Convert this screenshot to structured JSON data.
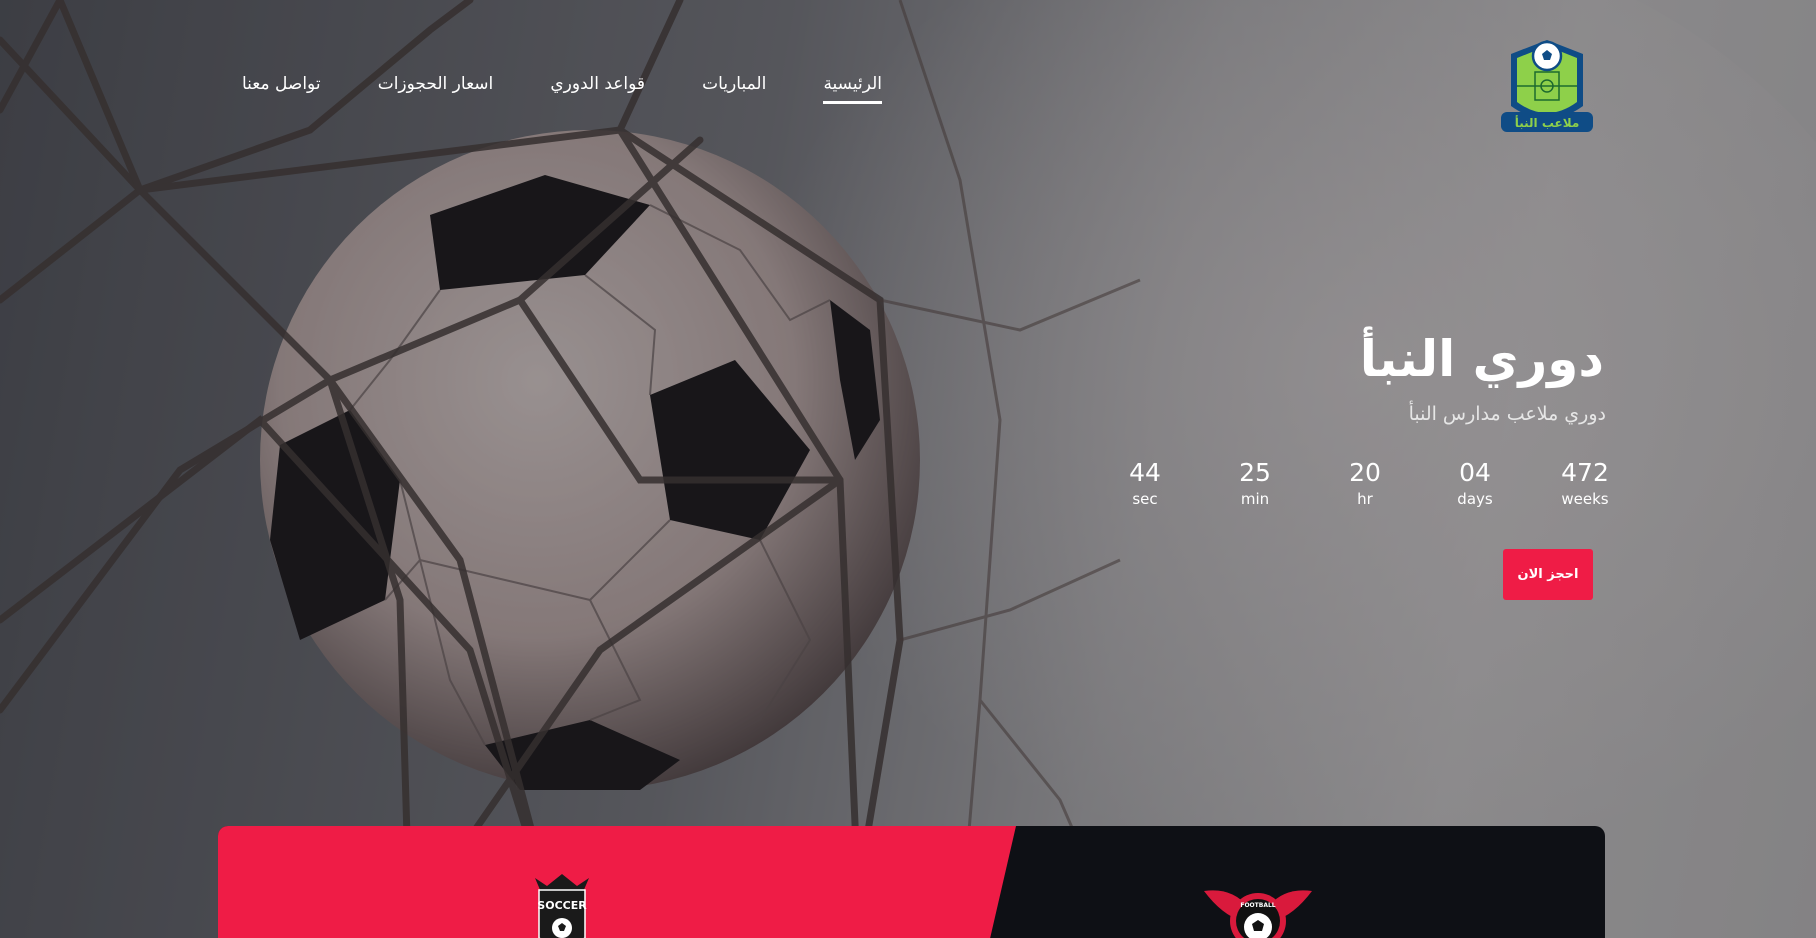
{
  "nav": {
    "items": [
      {
        "label": "الرئيسية",
        "active": true
      },
      {
        "label": "المباريات",
        "active": false
      },
      {
        "label": "قواعد الدوري",
        "active": false
      },
      {
        "label": "اسعار الحجوزات",
        "active": false
      },
      {
        "label": "تواصل معنا",
        "active": false
      }
    ]
  },
  "logo": {
    "text": "ملاعب النبأ"
  },
  "hero": {
    "title": "دوري النبأ",
    "subtitle": "دوري ملاعب مدارس النبأ",
    "countdown": [
      {
        "value": "472",
        "label": "weeks"
      },
      {
        "value": "04",
        "label": "days"
      },
      {
        "value": "20",
        "label": "hr"
      },
      {
        "value": "25",
        "label": "min"
      },
      {
        "value": "44",
        "label": "sec"
      }
    ],
    "cta_label": "احجز الان"
  },
  "match": {
    "left_team_badge_text": "SOCCER",
    "right_team_badge_text": "FOOTBALL"
  },
  "colors": {
    "accent": "#ef1c46",
    "dark": "#0e1015"
  }
}
